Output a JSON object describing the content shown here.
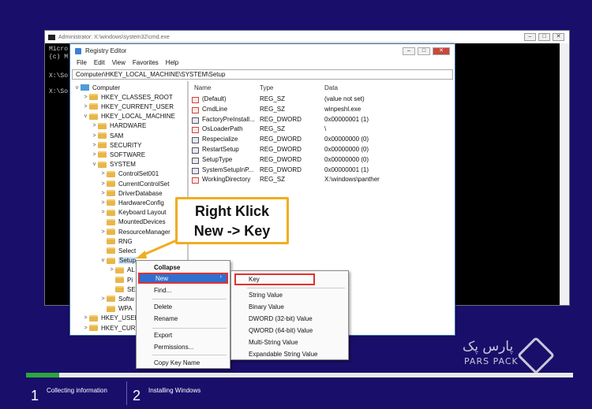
{
  "cmd": {
    "title": "Administrator: X:\\windows\\system32\\cmd.exe",
    "lines": [
      "Micro",
      "(c) M",
      "X:\\So",
      "X:\\So"
    ]
  },
  "regedit": {
    "title": "Registry Editor",
    "menu": [
      "File",
      "Edit",
      "View",
      "Favorites",
      "Help"
    ],
    "address": "Computer\\HKEY_LOCAL_MACHINE\\SYSTEM\\Setup",
    "tree": [
      {
        "label": "Computer",
        "chev": "v"
      },
      {
        "label": "HKEY_CLASSES_ROOT",
        "chev": ">"
      },
      {
        "label": "HKEY_CURRENT_USER",
        "chev": ">"
      },
      {
        "label": "HKEY_LOCAL_MACHINE",
        "chev": "v"
      },
      {
        "label": "HARDWARE",
        "chev": ">"
      },
      {
        "label": "SAM",
        "chev": ">"
      },
      {
        "label": "SECURITY",
        "chev": ">"
      },
      {
        "label": "SOFTWARE",
        "chev": ">"
      },
      {
        "label": "SYSTEM",
        "chev": "v"
      },
      {
        "label": "ControlSet001",
        "chev": ">"
      },
      {
        "label": "CurrentControlSet",
        "chev": ">"
      },
      {
        "label": "DriverDatabase",
        "chev": ">"
      },
      {
        "label": "HardwareConfig",
        "chev": ">"
      },
      {
        "label": "Keyboard Layout",
        "chev": ">"
      },
      {
        "label": "MountedDevices",
        "chev": ""
      },
      {
        "label": "ResourceManager",
        "chev": ">"
      },
      {
        "label": "RNG",
        "chev": ""
      },
      {
        "label": "Select",
        "chev": ""
      },
      {
        "label": "Setup",
        "chev": "v"
      },
      {
        "label": "AL",
        "chev": ">"
      },
      {
        "label": "Pi",
        "chev": ""
      },
      {
        "label": "SE",
        "chev": ""
      },
      {
        "label": "Softw",
        "chev": ">"
      },
      {
        "label": "WPA",
        "chev": ""
      },
      {
        "label": "HKEY_USER",
        "chev": ">"
      },
      {
        "label": "HKEY_CURI",
        "chev": ">"
      }
    ],
    "columns": [
      "Name",
      "Type",
      "Data"
    ],
    "values": [
      {
        "name": "(Default)",
        "type": "REG_SZ",
        "data": "(value not set)",
        "icon": "ab"
      },
      {
        "name": "CmdLine",
        "type": "REG_SZ",
        "data": "winpeshl.exe",
        "icon": "ab"
      },
      {
        "name": "FactoryPreInstall...",
        "type": "REG_DWORD",
        "data": "0x00000001 (1)",
        "icon": "bin"
      },
      {
        "name": "OsLoaderPath",
        "type": "REG_SZ",
        "data": "\\",
        "icon": "ab"
      },
      {
        "name": "Respecialize",
        "type": "REG_DWORD",
        "data": "0x00000000 (0)",
        "icon": "bin"
      },
      {
        "name": "RestartSetup",
        "type": "REG_DWORD",
        "data": "0x00000000 (0)",
        "icon": "bin"
      },
      {
        "name": "SetupType",
        "type": "REG_DWORD",
        "data": "0x00000000 (0)",
        "icon": "bin"
      },
      {
        "name": "SystemSetupInP...",
        "type": "REG_DWORD",
        "data": "0x00000001 (1)",
        "icon": "bin"
      },
      {
        "name": "WorkingDirectory",
        "type": "REG_SZ",
        "data": "X:\\windows\\panther",
        "icon": "ab"
      }
    ]
  },
  "context_menu": {
    "items": [
      "Collapse",
      "New",
      "Find...",
      "Delete",
      "Rename",
      "Export",
      "Permissions...",
      "Copy Key Name"
    ]
  },
  "submenu": {
    "items": [
      "Key",
      "String Value",
      "Binary Value",
      "DWORD (32-bit) Value",
      "QWORD (64-bit) Value",
      "Multi-String Value",
      "Expandable String Value"
    ]
  },
  "callout": {
    "line1": "Right Klick",
    "line2": "New -> Key",
    "border_color": "#f0ad1e"
  },
  "logo": {
    "persian": "پارس پک",
    "latin": "PARS PACK"
  },
  "setup_steps": [
    {
      "num": "1",
      "label": "Collecting information"
    },
    {
      "num": "2",
      "label": "Installing Windows"
    }
  ],
  "progress": {
    "fraction": 0.06,
    "color": "#2ca63c"
  },
  "colors": {
    "background": "#1a0e6b",
    "highlight": "#2f6fcf",
    "marker": "#e23030"
  }
}
